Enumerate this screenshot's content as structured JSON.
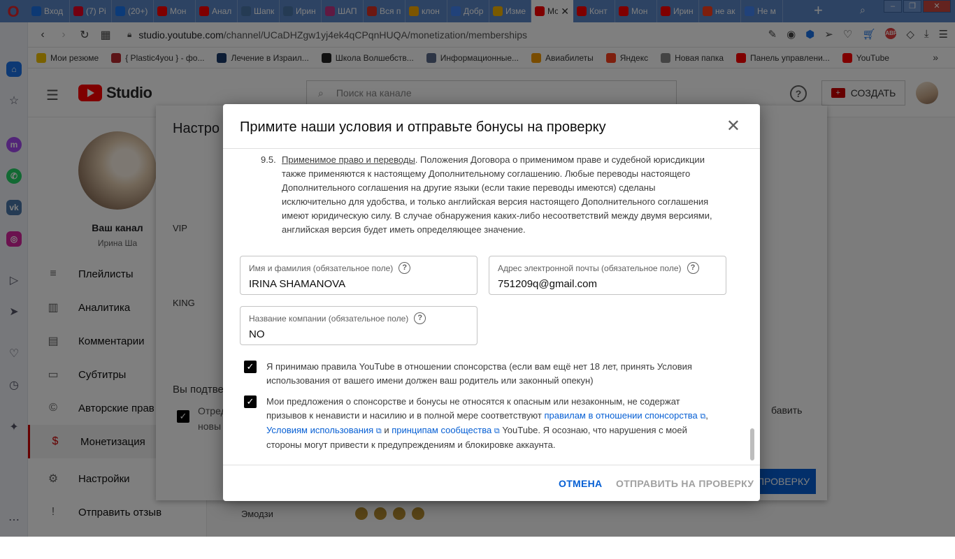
{
  "browser": {
    "tabs": [
      {
        "label": "Вход",
        "icon_color": "#1a73e8"
      },
      {
        "label": "(7) Pi",
        "icon_color": "#e60023"
      },
      {
        "label": "(20+)",
        "icon_color": "#1877f2"
      },
      {
        "label": "Мон",
        "icon_color": "#ff0000"
      },
      {
        "label": "Анал",
        "icon_color": "#ff0000"
      },
      {
        "label": "Шапк",
        "icon_color": "#4a76a8"
      },
      {
        "label": "Ирин",
        "icon_color": "#4a76a8"
      },
      {
        "label": "ШАП",
        "icon_color": "#c13584"
      },
      {
        "label": "Вся п",
        "icon_color": "#d93025"
      },
      {
        "label": "клон",
        "icon_color": "#f9ab00"
      },
      {
        "label": "Добр",
        "icon_color": "#4285f4"
      },
      {
        "label": "Изме",
        "icon_color": "#f4b400"
      },
      {
        "label": "Мо",
        "icon_color": "#ff0000",
        "active": true
      },
      {
        "label": "Конт",
        "icon_color": "#ff0000"
      },
      {
        "label": "Мон",
        "icon_color": "#ff0000"
      },
      {
        "label": "Ирин",
        "icon_color": "#ff0000"
      },
      {
        "label": "не ак",
        "icon_color": "#fc3f1d"
      },
      {
        "label": "Не м",
        "icon_color": "#4285f4"
      }
    ],
    "url_host": "studio.youtube.com",
    "url_path": "/channel/UCaDHZgw1yj4ek4qCPqnHUQA/monetization/memberships",
    "abp_label": "ABP",
    "bookmarks": [
      {
        "label": "Мои резюме",
        "icon_color": "#f2c200"
      },
      {
        "label": "{ Plastic4you } - фо...",
        "icon_color": "#b8292f"
      },
      {
        "label": "Лечение в Израил...",
        "icon_color": "#1b3a6b"
      },
      {
        "label": "Школа Волшебств...",
        "icon_color": "#222222"
      },
      {
        "label": "Информационные...",
        "icon_color": "#5b6b8a"
      },
      {
        "label": "Авиабилеты",
        "icon_color": "#f29900"
      },
      {
        "label": "Яндекс",
        "icon_color": "#fc3f1d"
      },
      {
        "label": "Новая папка",
        "icon_color": "#888888"
      },
      {
        "label": "Панель управлени...",
        "icon_color": "#ff0000"
      },
      {
        "label": "YouTube",
        "icon_color": "#ff0000"
      }
    ]
  },
  "studio": {
    "logo_text": "Studio",
    "search_placeholder": "Поиск на канале",
    "create_label": "СОЗДАТЬ",
    "channel_title": "Ваш канал",
    "channel_name": "Ирина Ша",
    "nav": [
      {
        "label": "Плейлисты",
        "icon": "playlist-icon",
        "glyph": "≡"
      },
      {
        "label": "Аналитика",
        "icon": "analytics-icon",
        "glyph": "▥"
      },
      {
        "label": "Комментарии",
        "icon": "comments-icon",
        "glyph": "▤"
      },
      {
        "label": "Субтитры",
        "icon": "subtitles-icon",
        "glyph": "▭"
      },
      {
        "label": "Авторские прав",
        "icon": "copyright-icon",
        "glyph": "©"
      },
      {
        "label": "Монетизация",
        "icon": "dollar-icon",
        "glyph": "$",
        "active": true
      },
      {
        "label": "Настройки",
        "icon": "gear-icon",
        "glyph": "⚙"
      },
      {
        "label": "Отправить отзыв",
        "icon": "feedback-icon",
        "glyph": "!"
      }
    ],
    "bg_dialog": {
      "title": "Настро",
      "vip": "VIP",
      "king": "KING",
      "confirm": "Вы подтве",
      "checkbox_text_1": "Отред",
      "checkbox_text_2": "новы",
      "add_text": "бавить",
      "submit_label": "ПРОВЕРКУ"
    },
    "emoji_label": "Эмодзи"
  },
  "modal": {
    "title": "Примите наши условия и отправьте бонусы на проверку",
    "clause_number": "9.5.",
    "clause_heading": "Применимое право и переводы",
    "clause_body": ". Положения Договора о применимом праве и судебной юрисдикции также применяются к настоящему Дополнительному соглашению. Любые переводы настоящего Дополнительного соглашения на другие языки (если такие переводы имеются) сделаны исключительно для удобства, и только английская версия настоящего Дополнительного соглашения имеют юридическую силу. В случае обнаружения каких-либо несоответствий между двумя версиями, английская версия будет иметь определяющее значение.",
    "fields": {
      "name_label": "Имя и фамилия (обязательное поле)",
      "name_value": "IRINA SHAMANOVA",
      "email_label": "Адрес электронной почты (обязательное поле)",
      "email_value": "751209q@gmail.com",
      "company_label": "Название компании (обязательное поле)",
      "company_value": "NO"
    },
    "checkbox_1": "Я принимаю правила YouTube в отношении спонсорства (если вам ещё нет 18 лет, принять Условия использования от вашего имени должен ваш родитель или законный опекун)",
    "checkbox_2_start": "Мои предложения о спонсорстве и бонусы не относятся к опасным или незаконным, не содержат призывов к ненависти и насилию и в полной мере соответствуют ",
    "checkbox_2_link1": "правилам в отношении спонсорства",
    "checkbox_2_link2": "Условиям использования",
    "checkbox_2_and": " и ",
    "checkbox_2_link3": "принципам сообщества",
    "checkbox_2_end": " YouTube. Я осознаю, что нарушения с моей стороны могут привести к предупреждениям и блокировке аккаунта.",
    "cancel_label": "ОТМЕНА",
    "submit_label": "ОТПРАВИТЬ НА ПРОВЕРКУ"
  }
}
